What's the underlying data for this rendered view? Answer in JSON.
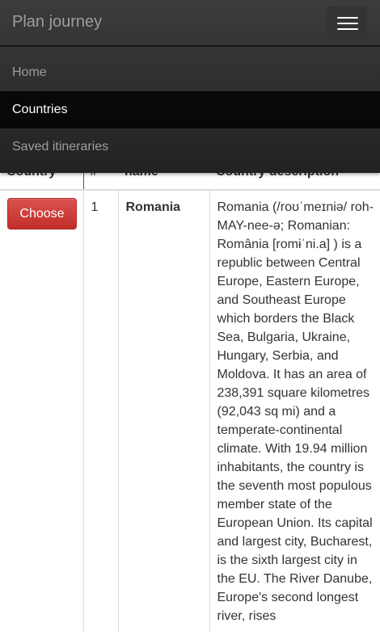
{
  "navbar": {
    "brand": "Plan journey",
    "toggle_icon": "hamburger-menu-icon",
    "items": [
      {
        "label": "Home",
        "active": false
      },
      {
        "label": "Countries",
        "active": true
      },
      {
        "label": "Saved itineraries",
        "active": false
      }
    ]
  },
  "table": {
    "headers": {
      "choose": "Country",
      "number": "#",
      "name": "name",
      "description": "Country description"
    },
    "rows": [
      {
        "button_label": "Choose",
        "number": "1",
        "name": "Romania",
        "description": "Romania (/roʊˈmeɪniə/ roh-MAY-nee-ə; Romanian: România [romɨˈni.a] ) is a republic between Central Europe, Eastern Europe, and Southeast Europe which borders the Black Sea, Bulgaria, Ukraine, Hungary, Serbia, and Moldova. It has an area of 238,391 square kilometres (92,043 sq mi) and a temperate-continental climate. With 19.94 million inhabitants, the country is the seventh most populous member state of the European Union. Its capital and largest city, Bucharest, is the sixth largest city in the EU. The River Danube, Europe's second longest river, rises"
      }
    ]
  },
  "colors": {
    "navbar_bg": "#222222",
    "active_item_bg": "#080808",
    "choose_button": "#d9534f"
  }
}
